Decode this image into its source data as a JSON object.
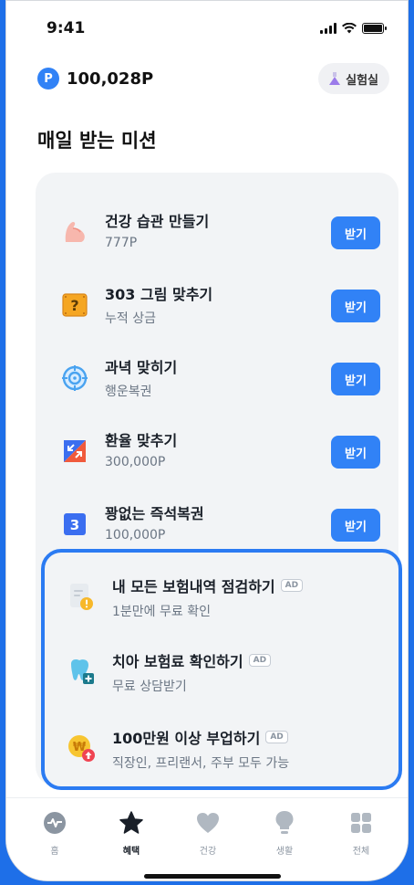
{
  "status_bar": {
    "time": "9:41"
  },
  "header": {
    "points_badge": "P",
    "points": "100,028P",
    "lab_button": "실험실"
  },
  "section_title": "매일 받는 미션",
  "missions": [
    {
      "title": "건강 습관 만들기",
      "subtitle": "777P",
      "button": "받기",
      "icon": "muscle-arm-icon"
    },
    {
      "title": "303 그림 맞추기",
      "subtitle": "누적 상금",
      "button": "받기",
      "icon": "question-box-icon"
    },
    {
      "title": "과녁 맞히기",
      "subtitle": "행운복권",
      "button": "받기",
      "icon": "target-icon"
    },
    {
      "title": "환율 맞추기",
      "subtitle": "300,000P",
      "button": "받기",
      "icon": "exchange-arrows-icon"
    },
    {
      "title": "꽝없는 즉석복권",
      "subtitle": "100,000P",
      "button": "받기",
      "icon": "number-three-icon",
      "icon_text": "3"
    }
  ],
  "ads": [
    {
      "title": "내 모든 보험내역 점검하기",
      "tag": "AD",
      "subtitle": "1분만에 무료 확인",
      "icon": "document-warning-icon"
    },
    {
      "title": "치아 보험료 확인하기",
      "tag": "AD",
      "subtitle": "무료 상담받기",
      "icon": "tooth-plus-icon"
    },
    {
      "title": "100만원 이상 부업하기",
      "tag": "AD",
      "subtitle": "직장인, 프리랜서, 주부 모두 가능",
      "icon": "won-coin-up-icon"
    }
  ],
  "tabs": [
    {
      "label": "홈",
      "icon": "pulse-icon",
      "active": false
    },
    {
      "label": "혜택",
      "icon": "star-icon",
      "active": true
    },
    {
      "label": "건강",
      "icon": "heart-icon",
      "active": false
    },
    {
      "label": "생활",
      "icon": "lightbulb-icon",
      "active": false
    },
    {
      "label": "전체",
      "icon": "grid-icon",
      "active": false
    }
  ],
  "colors": {
    "accent": "#3182f6",
    "ad_border": "#2b7bf2",
    "card_bg": "#f2f4f6"
  }
}
